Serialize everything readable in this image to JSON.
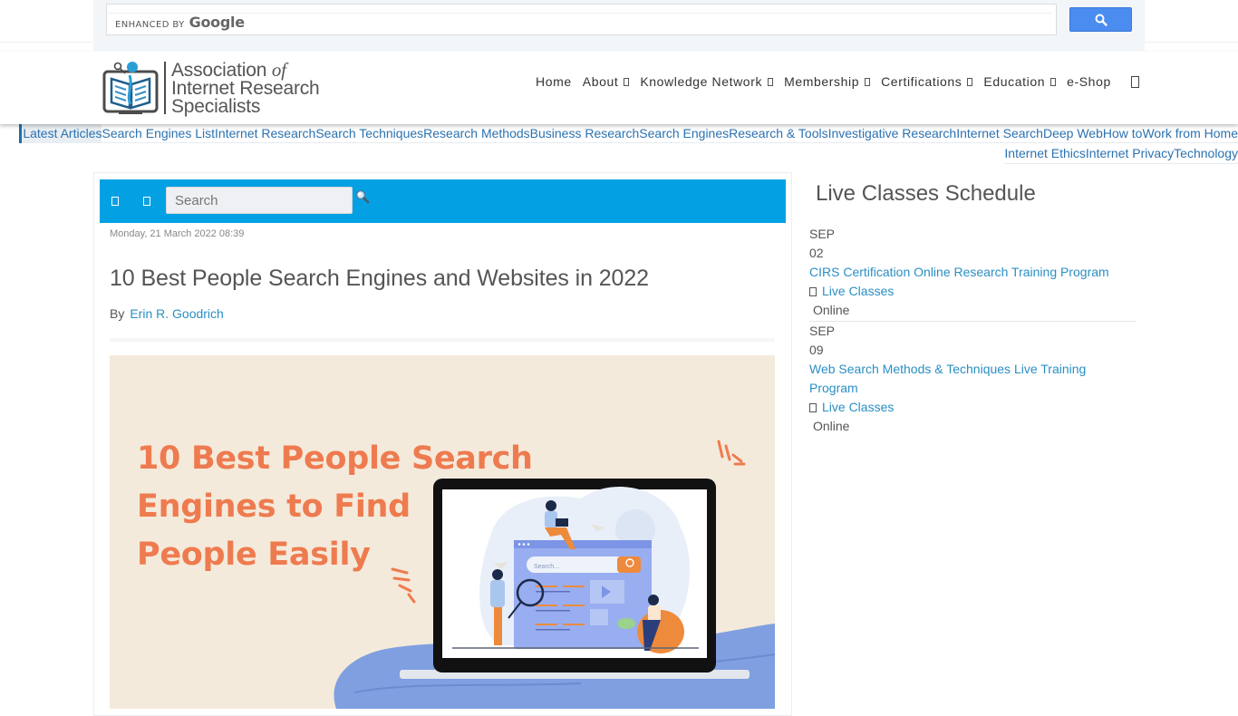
{
  "google_search": {
    "enhanced_label": "ENHANCED BY",
    "brand": "Google",
    "button_icon": "search-icon",
    "colors": {
      "button": "#4a8cf0"
    }
  },
  "logo": {
    "line1": "Association",
    "line1_italic": "of",
    "line2": "Internet Research",
    "line3": "Specialists"
  },
  "nav": {
    "items": [
      {
        "label": "Home",
        "has_dropdown": false
      },
      {
        "label": "About",
        "has_dropdown": true
      },
      {
        "label": "Knowledge Network",
        "has_dropdown": true
      },
      {
        "label": "Membership",
        "has_dropdown": true
      },
      {
        "label": "Certifications",
        "has_dropdown": true
      },
      {
        "label": "Education",
        "has_dropdown": true
      },
      {
        "label": "e-Shop",
        "has_dropdown": false
      }
    ],
    "menu_icon": "menu-icon"
  },
  "categories": {
    "row1": [
      "Latest Articles",
      "Search Engines List",
      "Internet Research",
      "Search Techniques",
      "Research Methods",
      "Business Research",
      "Search Engines",
      "Research & Tools",
      "Investigative Research",
      "Internet Search",
      "Deep Web",
      "How to",
      "Work from Home"
    ],
    "row2": [
      "Internet Ethics",
      "Internet Privacy",
      "Technology"
    ],
    "active": "Latest Articles"
  },
  "article": {
    "toolbar": {
      "search_placeholder": "Search",
      "colors": {
        "bar": "#03a1e3"
      }
    },
    "date": "Monday, 21 March 2022 08:39",
    "title": "10 Best People Search Engines and Websites in 2022",
    "by_label": "By",
    "author": "Erin R. Goodrich",
    "hero": {
      "line1": "10 Best People Search",
      "line2": "Engines to Find",
      "line3": "People Easily",
      "screen_search_text": "Search...",
      "colors": {
        "background": "#f4eadb",
        "text": "#ee7b4f",
        "platform": "#7f9fe0"
      }
    }
  },
  "sidebar": {
    "title": "Live Classes Schedule",
    "events": [
      {
        "month": "SEP",
        "day": "02",
        "title": "CIRS Certification Online Research Training Program",
        "category": "Live Classes",
        "location": "Online"
      },
      {
        "month": "SEP",
        "day": "09",
        "title": "Web Search Methods & Techniques Live Training Program",
        "category": "Live Classes",
        "location": "Online"
      }
    ]
  }
}
